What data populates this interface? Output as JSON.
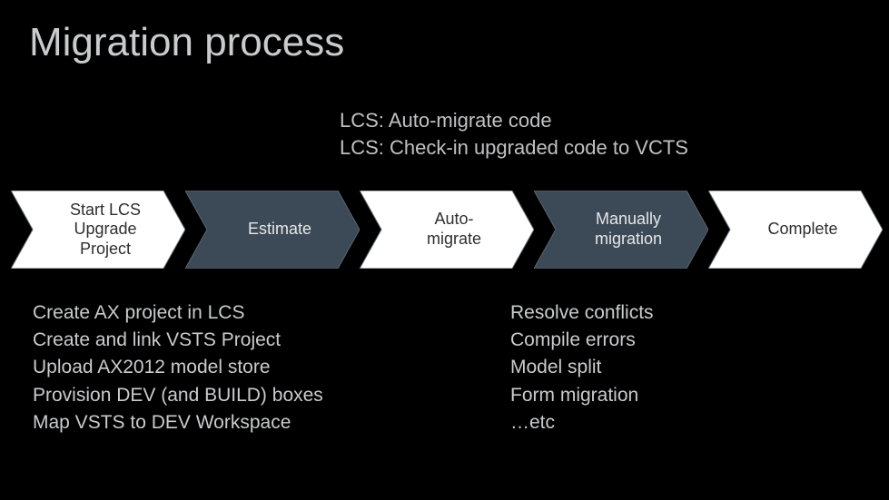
{
  "title": "Migration process",
  "subtitle": {
    "line1": "LCS: Auto-migrate code",
    "line2": "LCS: Check-in upgraded code to VCTS"
  },
  "steps": [
    {
      "label": "Start LCS\nUpgrade\nProject",
      "fill": "#ffffff",
      "text_dark": true
    },
    {
      "label": "Estimate",
      "fill": "#3b4a56",
      "text_dark": false
    },
    {
      "label": "Auto-\nmigrate",
      "fill": "#ffffff",
      "text_dark": true
    },
    {
      "label": "Manually\nmigration",
      "fill": "#3b4a56",
      "text_dark": false
    },
    {
      "label": "Complete",
      "fill": "#ffffff",
      "text_dark": true
    }
  ],
  "notes_left": [
    "Create AX project in LCS",
    "Create and link VSTS Project",
    "Upload AX2012 model store",
    "Provision DEV (and BUILD) boxes",
    "Map VSTS to DEV Workspace"
  ],
  "notes_right": [
    "Resolve conflicts",
    "Compile errors",
    "Model split",
    "Form migration",
    "…etc"
  ],
  "chart_data": {
    "type": "process-chevron",
    "steps": [
      "Start LCS Upgrade Project",
      "Estimate",
      "Auto-migrate",
      "Manually migration",
      "Complete"
    ]
  }
}
